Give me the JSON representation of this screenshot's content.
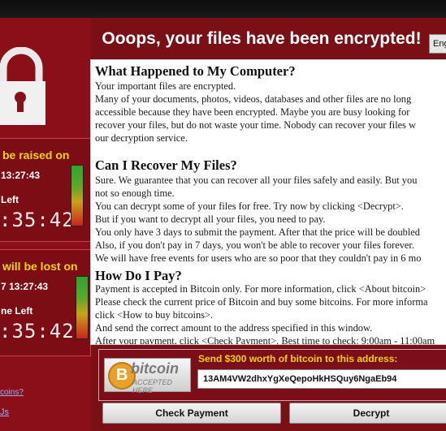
{
  "window": {
    "title": "Ooops, your files have been encrypted!",
    "language": "Eng"
  },
  "timers": [
    {
      "heading": "be raised on",
      "date": "13:27:43",
      "time_left_label": "Left",
      "countdown": ":35:42"
    },
    {
      "heading": "will be lost on",
      "date": "7 13:27:43",
      "time_left_label": "ne Left",
      "countdown": ":35:42"
    }
  ],
  "links": {
    "about_bitcoin": "coins?",
    "contact_us": "Js"
  },
  "main": {
    "sections": [
      {
        "heading": "What Happened to My Computer?",
        "lines": [
          "Your important files are encrypted.",
          "Many of your documents, photos, videos, databases and other files are no long",
          "accessible because they have been encrypted. Maybe you are busy looking for",
          "recover your files, but do not waste your time. Nobody can recover your files w",
          "our decryption service."
        ]
      },
      {
        "heading": "Can I Recover My Files?",
        "lines": [
          "Sure. We guarantee that you can recover all your files safely and easily. But you",
          "not so enough time.",
          "You can decrypt some of your files for free. Try now by clicking <Decrypt>.",
          "But if you want to decrypt all your files, you need to pay.",
          "You only have 3 days to submit the payment. After that the price will be doubled",
          "Also, if you don't pay in 7 days, you won't be able to recover your files forever.",
          "We will have free events for users who are so poor that they couldn't pay in 6 mo"
        ]
      },
      {
        "heading": "How Do I Pay?",
        "lines": [
          "Payment is accepted in Bitcoin only. For more information, click <About bitcoin>",
          "Please check the current price of Bitcoin and buy some bitcoins. For more informa",
          "click <How to buy bitcoins>.",
          "And send the correct amount to the address specified in this window.",
          "After your payment, click <Check Payment>. Best time to check: 9:00am - 11:00am"
        ]
      }
    ]
  },
  "bitcoin": {
    "logo_text": "bitcoin",
    "logo_sub": "ACCEPTED HERE",
    "send_label": "Send $300 worth of bitcoin to this address:",
    "address": "13AM4VW2dhxYgXeQepoHkHSQuy6NgaEb94"
  },
  "buttons": {
    "check_payment": "Check Payment",
    "decrypt": "Decrypt"
  },
  "colors": {
    "background": "#7a0f16",
    "accent_yellow": "#f3d300",
    "panel": "#ffffff"
  }
}
